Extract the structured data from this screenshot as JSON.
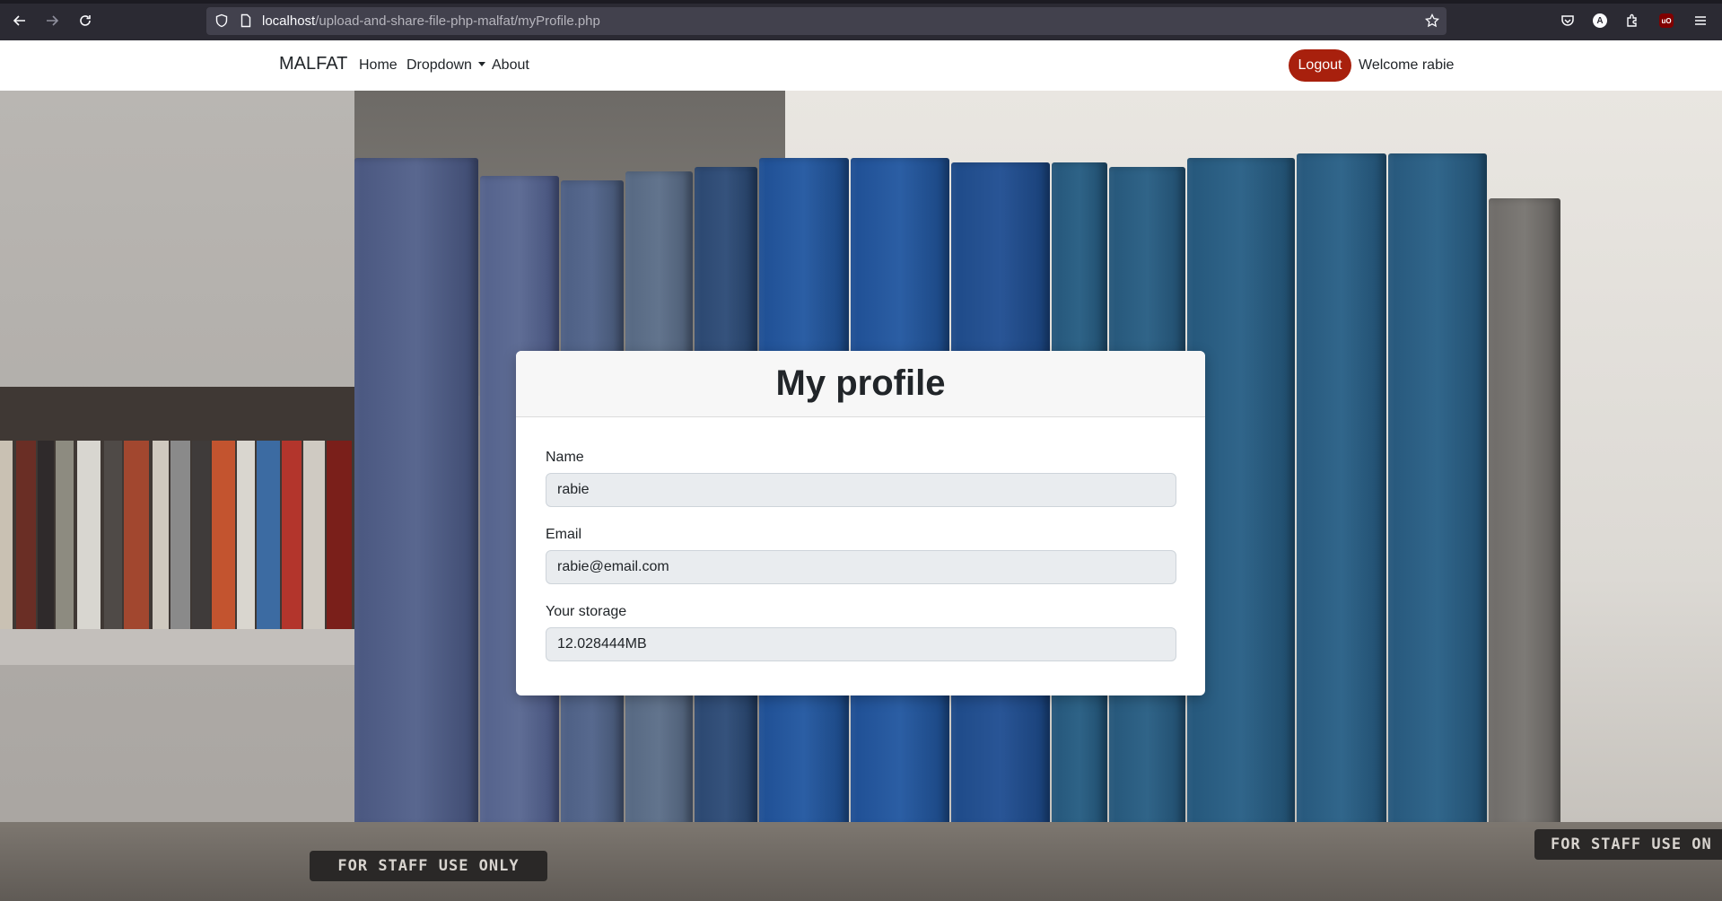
{
  "browser": {
    "url_host": "localhost",
    "url_path": "/upload-and-share-file-php-malfat/myProfile.php",
    "icons": [
      "back-icon",
      "forward-icon",
      "reload-icon",
      "shield-icon",
      "page-icon",
      "star-icon",
      "pocket-icon",
      "account-icon",
      "extensions-icon",
      "ublock-icon",
      "menu-icon"
    ],
    "account_letter": "A",
    "ublock_label": "uO"
  },
  "navbar": {
    "brand": "MALFAT",
    "links": {
      "home": "Home",
      "dropdown": "Dropdown",
      "about": "About"
    },
    "logout_label": "Logout",
    "welcome_text": "Welcome rabie"
  },
  "background": {
    "staff_label": "FOR STAFF USE ONLY",
    "staff_label_right": "FOR STAFF USE ON"
  },
  "profile": {
    "title": "My profile",
    "name_label": "Name",
    "name_value": "rabie",
    "email_label": "Email",
    "email_value": "rabie@email.com",
    "storage_label": "Your storage",
    "storage_value": "12.028444MB"
  },
  "colors": {
    "logout_bg": "#a8200d",
    "navbar_bg": "#ffffff",
    "input_bg": "#e9ecef",
    "chrome_bg": "#2b2a33",
    "urlbar_bg": "#42414d"
  }
}
